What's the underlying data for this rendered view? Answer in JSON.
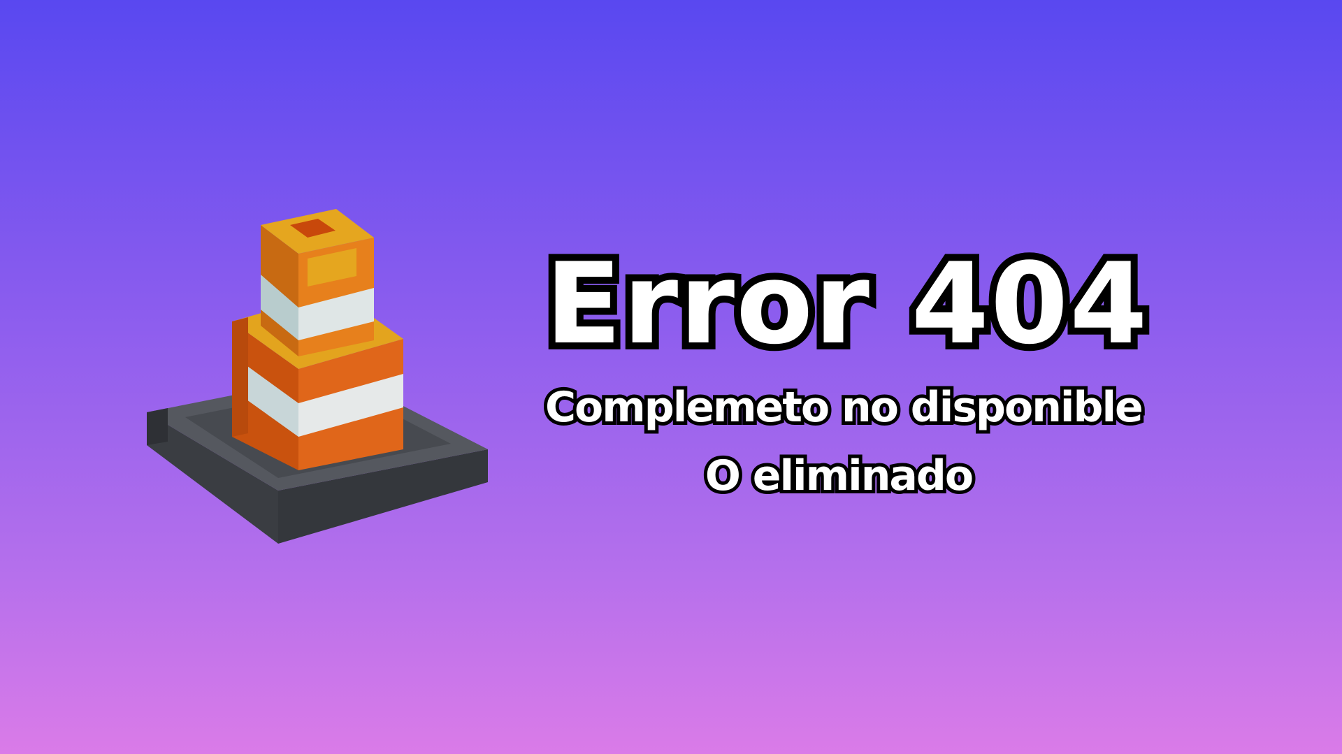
{
  "title": "Error 404",
  "subtitle_line1": "Complemeto no disponible",
  "subtitle_line2": "O eliminado",
  "colors": {
    "background_top": "#5948f0",
    "background_bottom": "#da7be8",
    "text": "#ffffff",
    "text_outline": "#000000"
  }
}
